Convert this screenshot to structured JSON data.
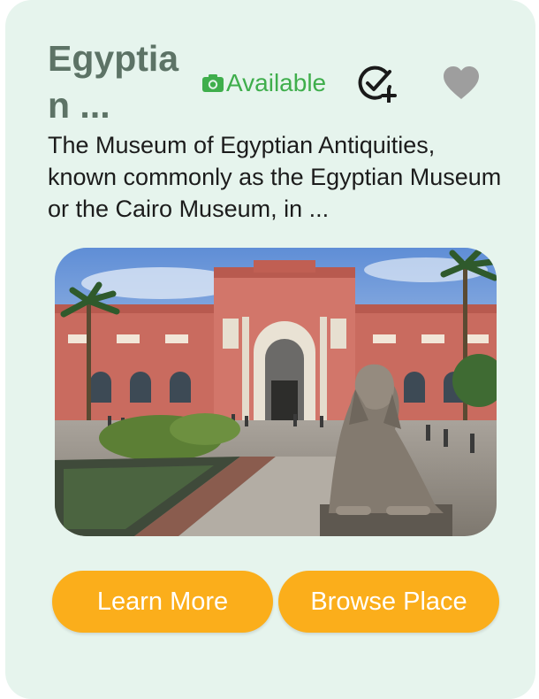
{
  "place": {
    "title": "Egyptia\nn ...",
    "availability_label": "Available",
    "description": "The Museum of Egyptian Antiquities, known commonly as the Egyptian Museum or the Cairo Museum, in ..."
  },
  "icons": {
    "availability": "camera-icon",
    "visit": "check-circle-plus-icon",
    "favorite": "heart-icon"
  },
  "actions": {
    "learn_more": "Learn More",
    "browse_place": "Browse Place"
  },
  "colors": {
    "card_background": "#e6f4ed",
    "title": "#5d7366",
    "available": "#3fae4c",
    "button": "#fbae1b",
    "heart": "#9e9e9e"
  }
}
